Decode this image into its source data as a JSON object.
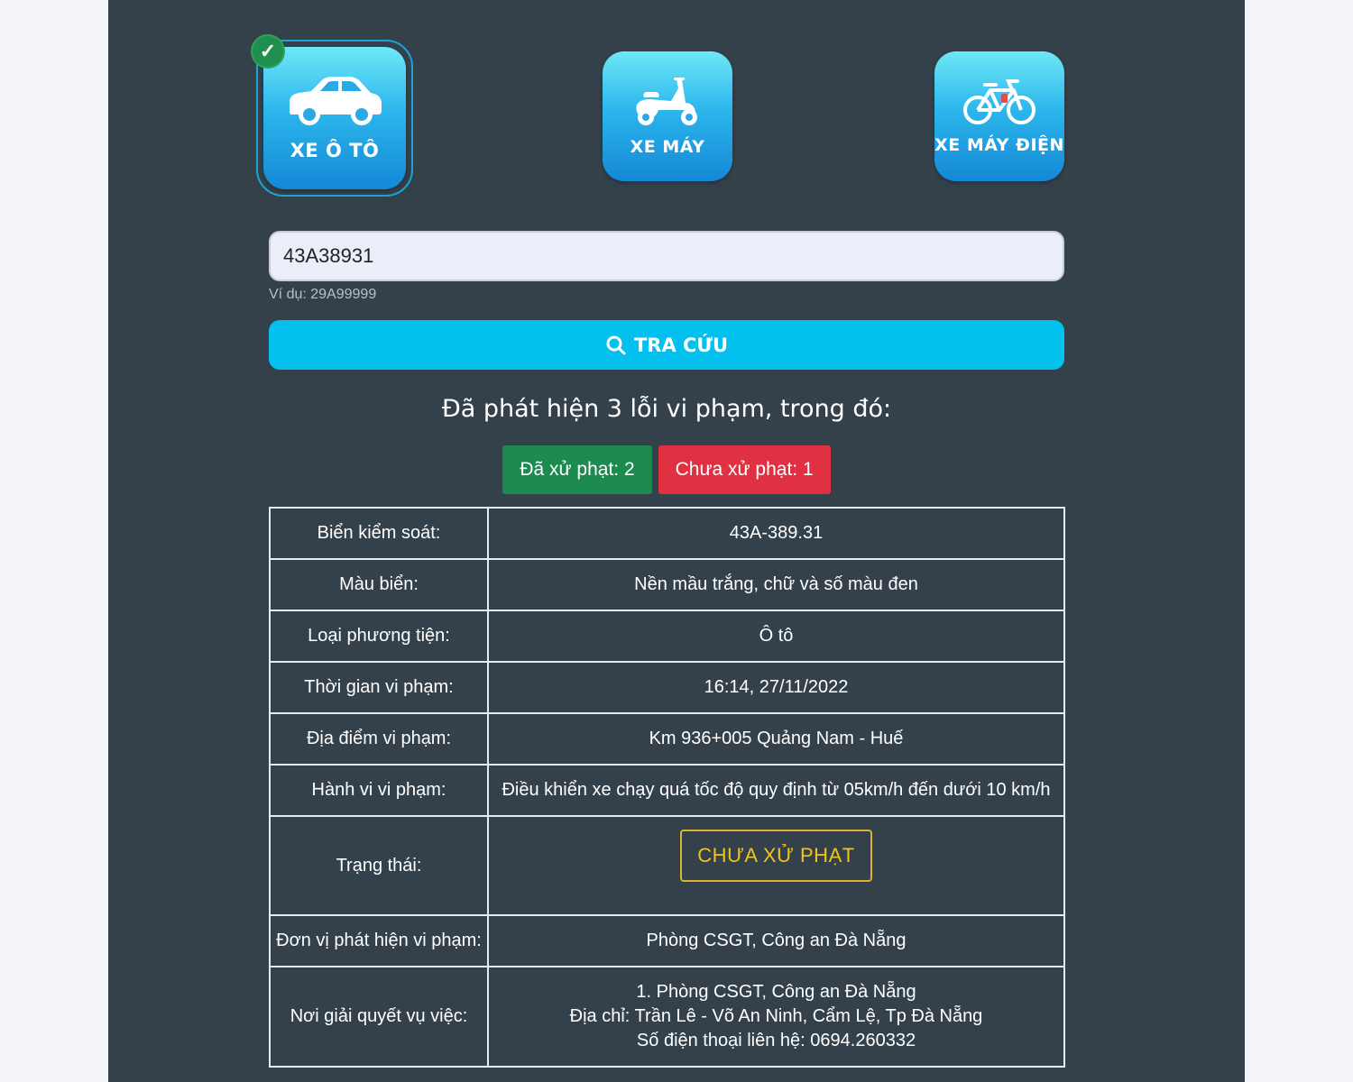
{
  "vehicles": [
    {
      "label": "XE Ô TÔ",
      "icon": "car-icon",
      "selected": true
    },
    {
      "label": "XE MÁY",
      "icon": "scooter-icon",
      "selected": false
    },
    {
      "label": "XE MÁY ĐIỆN",
      "icon": "bicycle-icon",
      "selected": false
    }
  ],
  "search": {
    "value": "43A38931",
    "hint": "Ví dụ: 29A99999",
    "button_label": "TRA CỨU"
  },
  "summary": {
    "text": "Đã phát hiện 3 lỗi vi phạm, trong đó:",
    "processed": "Đã xử phạt: 2",
    "unprocessed": "Chưa xử phạt: 1"
  },
  "details": {
    "plate_label": "Biển kiểm soát:",
    "plate_value": "43A-389.31",
    "color_label": "Màu biển:",
    "color_value": "Nền mầu trắng, chữ và số màu đen",
    "type_label": "Loại phương tiện:",
    "type_value": "Ô tô",
    "time_label": "Thời gian vi phạm:",
    "time_value": "16:14, 27/11/2022",
    "place_label": "Địa điểm vi phạm:",
    "place_value": "Km 936+005 Quảng Nam - Huế",
    "behavior_label": "Hành vi vi phạm:",
    "behavior_value": "Điều khiển xe chạy quá tốc độ quy định từ 05km/h đến dưới 10 km/h",
    "status_label": "Trạng thái:",
    "status_value": "CHƯA XỬ PHẠT",
    "unit_label": "Đơn vị phát hiện vi phạm:",
    "unit_value": "Phòng CSGT, Công an Đà Nẵng",
    "resolve_label": "Nơi giải quyết vụ việc:",
    "resolve_line1": "1. Phòng CSGT, Công an Đà Nẵng",
    "resolve_line2": "Địa chỉ: Trần Lê - Võ An Ninh, Cẩm Lệ, Tp Đà Nẵng",
    "resolve_line3": "Số điện thoại liên hệ: 0694.260332"
  },
  "colors": {
    "panel": "#34404a",
    "accent": "#03c0ee",
    "green": "#1d8a4f",
    "red": "#df3142",
    "warning": "#f0c419"
  }
}
